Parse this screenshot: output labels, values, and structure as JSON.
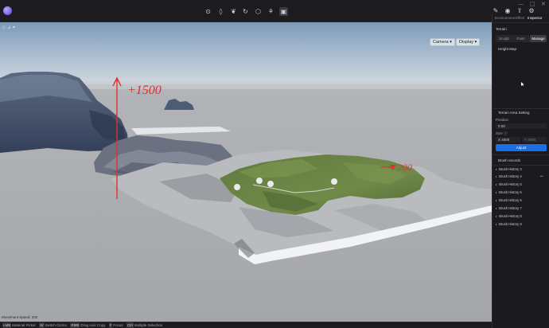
{
  "toolbar": {
    "window_controls": [
      "—",
      "□",
      "✕"
    ],
    "tools": [
      {
        "name": "pin-tool-icon",
        "glyph": "⊙"
      },
      {
        "name": "sculpt-tool-icon",
        "glyph": "◊"
      },
      {
        "name": "leaf-tool-icon",
        "glyph": "❦"
      },
      {
        "name": "cycle-tool-icon",
        "glyph": "↻"
      },
      {
        "name": "shield-tool-icon",
        "glyph": "⬡"
      },
      {
        "name": "brush-tool-icon",
        "glyph": "⚘"
      },
      {
        "name": "image-tool-icon",
        "glyph": "▣"
      }
    ],
    "right_icons": [
      {
        "name": "edit-icon",
        "glyph": "✎"
      },
      {
        "name": "camera-icon",
        "glyph": "◉"
      },
      {
        "name": "export-icon",
        "glyph": "⇪"
      },
      {
        "name": "settings-icon",
        "glyph": "⚙"
      }
    ]
  },
  "viewport": {
    "left_controls": "⊹ ⊿ ▾",
    "camera_label": "Camera ▾",
    "display_label": "Display ▾",
    "annotation_height": "+1500",
    "annotation_depth": "▼200",
    "camera_info": "Movement Speed: 200",
    "accent_color": "#e03030"
  },
  "statusbar": {
    "items": [
      {
        "key": "LMB",
        "label": "Material Picker"
      },
      {
        "key": "W",
        "label": "Switch Gizmo"
      },
      {
        "key": "RMB",
        "label": "Drag Axis Copy"
      },
      {
        "key": "F",
        "label": "Focus"
      },
      {
        "key": "Ctrl",
        "label": "Multiple Selection"
      }
    ]
  },
  "panel": {
    "tabs": [
      "Environment",
      "Effect",
      "Inspector"
    ],
    "active_tab": "Inspector",
    "section_title": "Terrain",
    "mode_tabs": [
      "Sculpt",
      "Paint",
      "Manage"
    ],
    "active_mode": "Manage",
    "height_map_label": "Height Map",
    "area_title": "Terrain Area Setting",
    "position_label": "Position",
    "position_value": "0.00",
    "size_label": "Size ⓘ",
    "size_x_label": "X",
    "size_x_value": "4000",
    "size_y_label": "Y",
    "size_y_value": "4000",
    "adjust_button": "Adjust",
    "brush_records_label": "Brush records",
    "brush_history": [
      "Brush History 3",
      "Brush History 4",
      "Brush History 5",
      "Brush History 6",
      "Brush History 6",
      "Brush History 7",
      "Brush History 8",
      "Brush History 9"
    ],
    "active_history_more": "•••"
  }
}
